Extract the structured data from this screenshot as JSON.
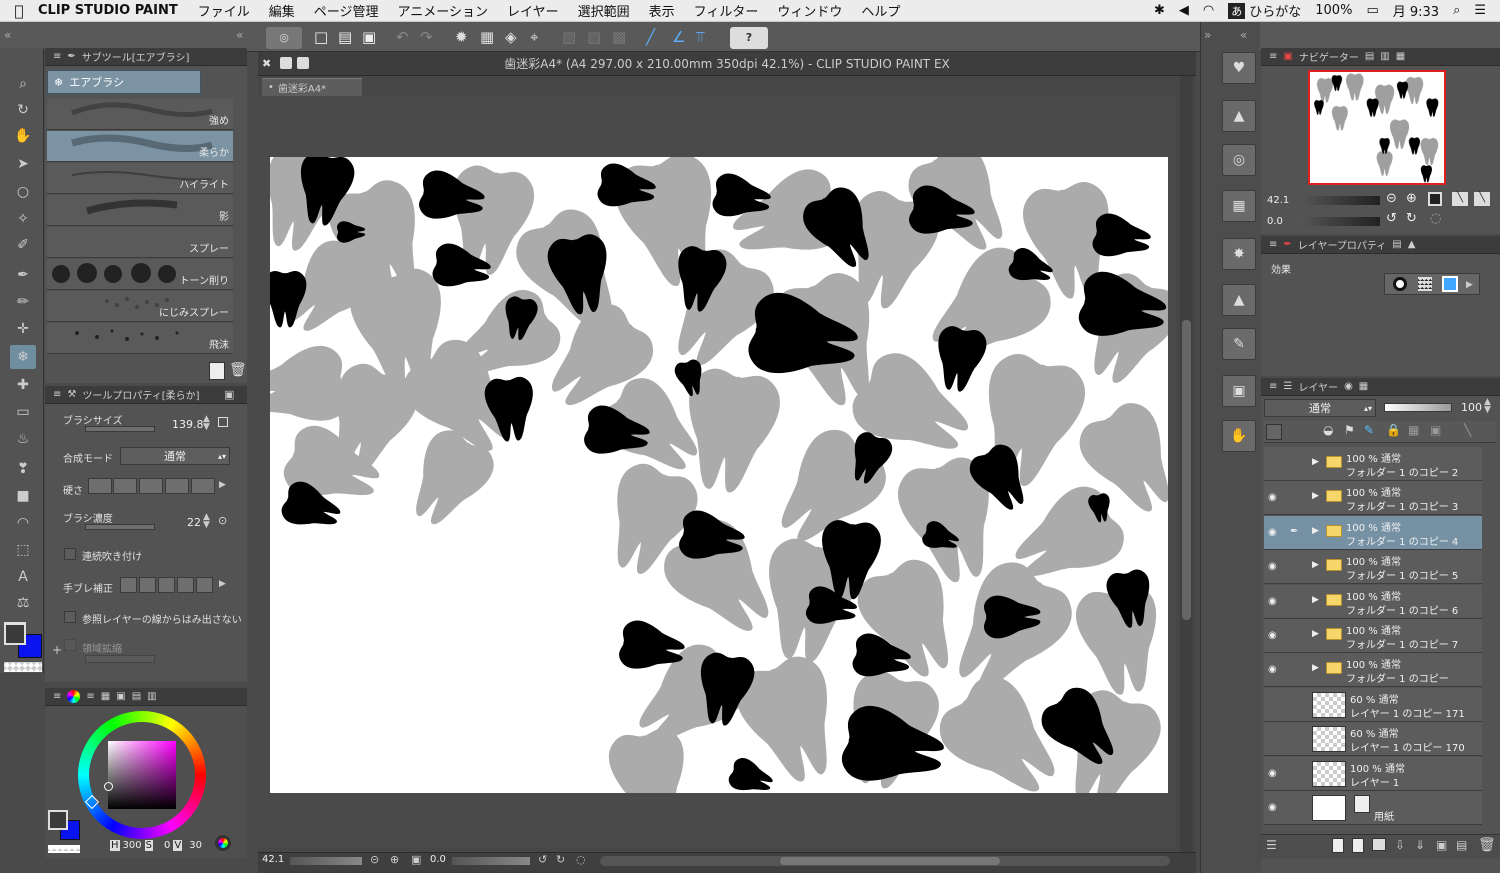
{
  "menubar": {
    "app": "CLIP STUDIO PAINT",
    "items": [
      "ファイル",
      "編集",
      "ページ管理",
      "アニメーション",
      "レイヤー",
      "選択範囲",
      "表示",
      "フィルター",
      "ウィンドウ",
      "ヘルプ"
    ],
    "input_mode_badge": "あ",
    "input_mode": "ひらがな",
    "battery": "100%",
    "clock": "月 9:33"
  },
  "window": {
    "title": "歯迷彩A4* (A4 297.00 x 210.00mm 350dpi 42.1%)  - CLIP STUDIO PAINT EX",
    "tab": "歯迷彩A4*"
  },
  "subtool": {
    "header": "サブツール[エアブラシ]",
    "group": "エアブラシ",
    "brushes": [
      "強め",
      "柔らか",
      "ハイライト",
      "影",
      "スプレー",
      "トーン削り",
      "にじみスプレー",
      "飛沫"
    ],
    "selected_index": 1
  },
  "tool_property": {
    "header": "ツールプロパティ[柔らか]",
    "brush_size_label": "ブラシサイズ",
    "brush_size_value": "139.8",
    "blend_mode_label": "合成モード",
    "blend_mode_value": "通常",
    "hardness_label": "硬さ",
    "density_label": "ブラシ濃度",
    "density_value": "22",
    "continuous_label": "連続吹き付け",
    "stabilizer_label": "手ブレ補正",
    "ref_layer_label": "参照レイヤーの線からはみ出さない",
    "area_expand_label": "領域拡縮"
  },
  "color": {
    "hsv": {
      "h_label": "H",
      "h": "300",
      "s_label": "S",
      "s": "0",
      "v_label": "V",
      "v": "30"
    },
    "main_color": "#3a3a3a",
    "sub_color": "#0a14f0"
  },
  "status": {
    "zoom": "42.1",
    "rotation": "0.0"
  },
  "navigator": {
    "header": "ナビゲーター",
    "zoom": "42.1",
    "rotation": "0.0"
  },
  "layer_property": {
    "header": "レイヤープロパティ",
    "effect_label": "効果"
  },
  "layers_panel": {
    "header": "レイヤー",
    "blend_mode": "通常",
    "opacity": "100",
    "layers": [
      {
        "line1": "100 % 通常",
        "line2": "フォルダー 1 のコピー 2",
        "type": "folder",
        "visible": false,
        "selected": false
      },
      {
        "line1": "100 % 通常",
        "line2": "フォルダー 1 のコピー 3",
        "type": "folder",
        "visible": true,
        "selected": false
      },
      {
        "line1": "100 % 通常",
        "line2": "フォルダー 1 のコピー 4",
        "type": "folder",
        "visible": true,
        "selected": true
      },
      {
        "line1": "100 % 通常",
        "line2": "フォルダー 1 のコピー 5",
        "type": "folder",
        "visible": true,
        "selected": false
      },
      {
        "line1": "100 % 通常",
        "line2": "フォルダー 1 のコピー 6",
        "type": "folder",
        "visible": true,
        "selected": false
      },
      {
        "line1": "100 % 通常",
        "line2": "フォルダー 1 のコピー 7",
        "type": "folder",
        "visible": true,
        "selected": false
      },
      {
        "line1": "100 % 通常",
        "line2": "フォルダー 1 のコピー",
        "type": "folder",
        "visible": true,
        "selected": false
      },
      {
        "line1": "60 % 通常",
        "line2": "レイヤー 1 のコピー 171",
        "type": "raster",
        "visible": false,
        "selected": false
      },
      {
        "line1": "60 % 通常",
        "line2": "レイヤー 1 のコピー 170",
        "type": "raster",
        "visible": false,
        "selected": false
      },
      {
        "line1": "100 % 通常",
        "line2": "レイヤー 1",
        "type": "raster",
        "visible": true,
        "selected": false
      },
      {
        "line1": "",
        "line2": "用紙",
        "type": "paper",
        "visible": true,
        "selected": false
      }
    ]
  }
}
